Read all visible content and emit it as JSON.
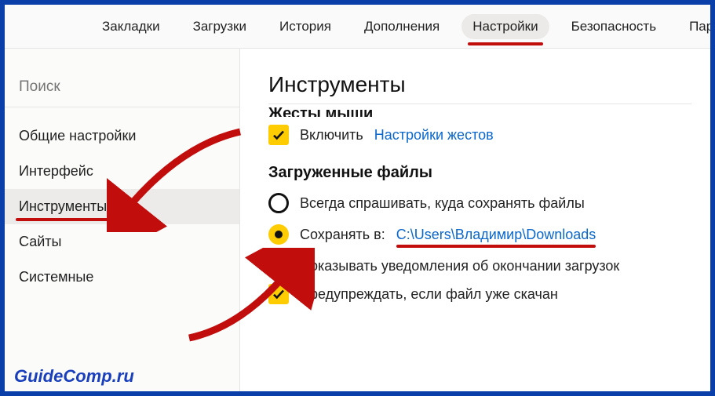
{
  "topbar": {
    "tabs": [
      {
        "label": "Закладки"
      },
      {
        "label": "Загрузки"
      },
      {
        "label": "История"
      },
      {
        "label": "Дополнения"
      },
      {
        "label": "Настройки",
        "active": true
      },
      {
        "label": "Безопасность"
      },
      {
        "label": "Пар"
      }
    ]
  },
  "sidebar": {
    "search_placeholder": "Поиск",
    "items": [
      {
        "label": "Общие настройки"
      },
      {
        "label": "Интерфейс"
      },
      {
        "label": "Инструменты",
        "selected": true
      },
      {
        "label": "Сайты"
      },
      {
        "label": "Системные"
      }
    ]
  },
  "main": {
    "title": "Инструменты",
    "section_prev": "Жесты мыши",
    "gestures": {
      "enable_label": "Включить",
      "settings_link": "Настройки жестов"
    },
    "downloads": {
      "title": "Загруженные файлы",
      "ask_label": "Всегда спрашивать, куда сохранять файлы",
      "save_in_label": "Сохранять в:",
      "path": "C:\\Users\\Владимир\\Downloads",
      "notify_label": "Показывать уведомления об окончании загрузок",
      "warn_label": "Предупреждать, если файл уже скачан"
    }
  },
  "watermark": "GuideComp.ru",
  "colors": {
    "frame": "#0a3ea8",
    "accent_yellow": "#ffcc00",
    "annotation_red": "#c20d0d",
    "link": "#0a67cc"
  }
}
